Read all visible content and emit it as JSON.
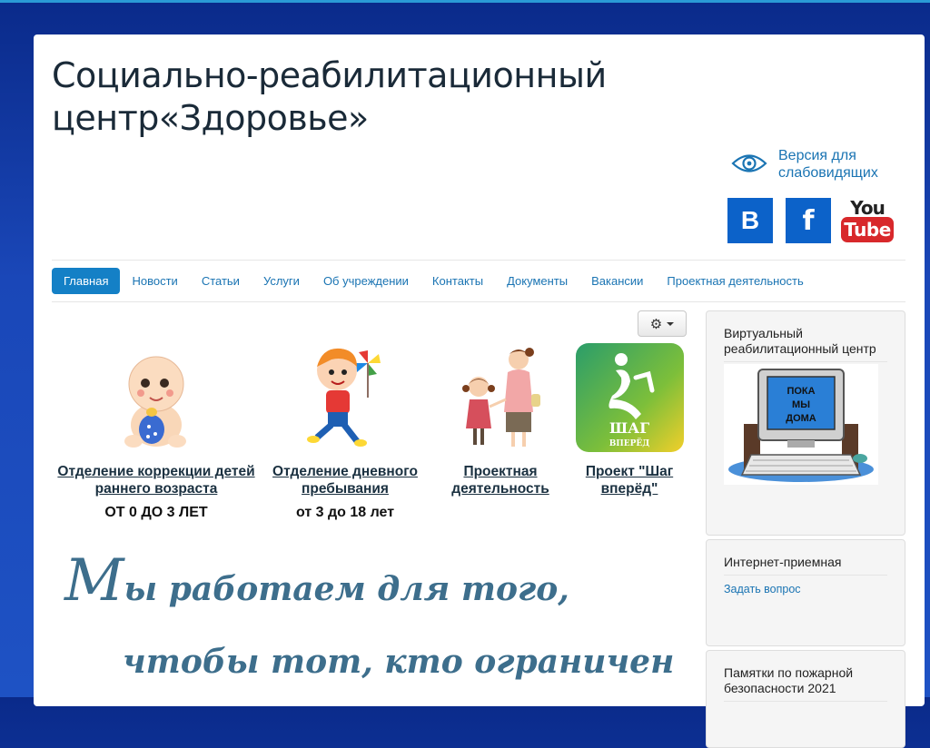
{
  "site": {
    "title_line1": "Социально-реабилитационный",
    "title_line2": "центр«Здоровье»"
  },
  "accessibility": {
    "label": "Версия для слабовидящих",
    "icon": "eye-icon"
  },
  "social": {
    "vk_label": "B",
    "fb_label": "f",
    "yt_you": "You",
    "yt_tube": "Tube"
  },
  "nav": {
    "items": [
      {
        "label": "Главная",
        "active": true
      },
      {
        "label": "Новости"
      },
      {
        "label": "Статьи"
      },
      {
        "label": "Услуги"
      },
      {
        "label": "Об учреждении"
      },
      {
        "label": "Контакты"
      },
      {
        "label": "Документы"
      },
      {
        "label": "Вакансии"
      },
      {
        "label": "Проектная деятельность"
      }
    ]
  },
  "tools": {
    "icon": "gear-icon"
  },
  "cards": [
    {
      "caption": "Отделение коррекции детей раннего возраста",
      "age": "ОТ 0 ДО 3 ЛЕТ"
    },
    {
      "caption": "Отделение дневного пребывания",
      "age": "от 3 до 18 лет"
    },
    {
      "caption": "Проектная деятельность",
      "age": ""
    },
    {
      "caption": "Проект \"Шаг вперёд\"",
      "age": "",
      "logo_text1": "ШАГ",
      "logo_text2": "ВПЕРЁД"
    }
  ],
  "motto": {
    "first_letter": "М",
    "line1": "ы работаем для того,",
    "line2": "чтобы тот, кто ограничен"
  },
  "sidebar": {
    "box1": {
      "title": "Виртуальный реабилитационный центр",
      "screen_text": [
        "ПОКА",
        "МЫ",
        "ДОМА"
      ]
    },
    "box2": {
      "title": "Интернет-приемная",
      "link": "Задать вопрос"
    },
    "box3": {
      "title": "Памятки по пожарной безопасности 2021"
    }
  },
  "colors": {
    "accent": "#1480c6",
    "link": "#1a74b3",
    "motto": "#3d6e8c",
    "background": "#1a47b8"
  }
}
